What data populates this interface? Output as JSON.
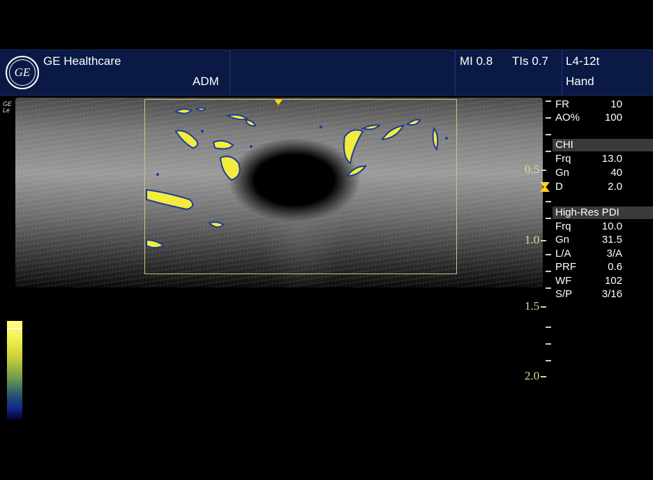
{
  "header": {
    "brand": "GE Healthcare",
    "logo_text": "GE",
    "mode": "ADM",
    "mi": "MI 0.8",
    "tis": "TIs 0.7",
    "probe": "L4-12t",
    "preset": "Hand"
  },
  "image_corner_label": "GE\nLe",
  "depth_labels": [
    "0.5",
    "1.0",
    "1.5",
    "2.0"
  ],
  "params_top": [
    {
      "label": "FR",
      "value": "10"
    },
    {
      "label": "AO%",
      "value": "100"
    }
  ],
  "chi_section": {
    "title": "CHI",
    "rows": [
      {
        "label": "Frq",
        "value": "13.0"
      },
      {
        "label": "Gn",
        "value": "40"
      },
      {
        "label": "D",
        "value": "2.0"
      }
    ]
  },
  "pdi_section": {
    "title": "High-Res PDI",
    "rows": [
      {
        "label": "Frq",
        "value": "10.0"
      },
      {
        "label": "Gn",
        "value": "31.5"
      },
      {
        "label": "L/A",
        "value": "3/A"
      },
      {
        "label": "PRF",
        "value": "0.6"
      },
      {
        "label": "WF",
        "value": "102"
      },
      {
        "label": "S/P",
        "value": "3/16"
      }
    ]
  },
  "colors": {
    "header_bg": "#0a1a45",
    "flow_yellow": "#f2ec3c",
    "flow_edge": "#1d3a9a",
    "roi_border": "#c9c28a",
    "depth_label": "#e2d98e",
    "focus_marker": "#ffd21a"
  }
}
